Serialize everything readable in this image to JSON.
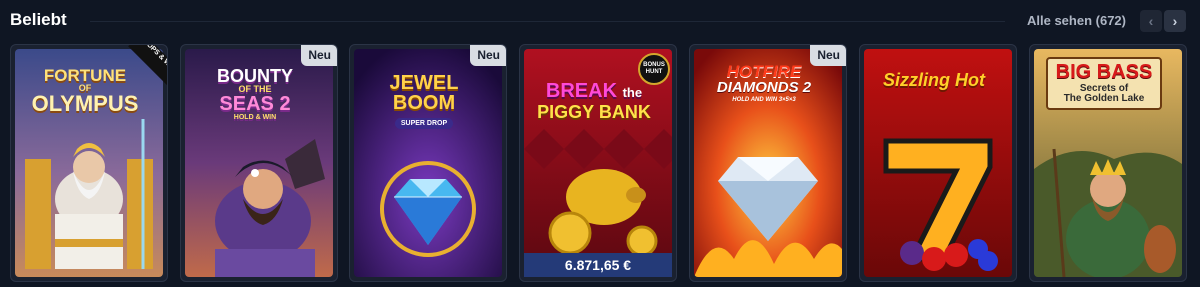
{
  "section": {
    "title": "Beliebt",
    "see_all_label": "Alle sehen (672)",
    "prev_icon": "‹",
    "next_icon": "›"
  },
  "games": [
    {
      "name": "Fortune of Olympus",
      "logo_line1": "FORTUNE",
      "logo_line2": "OF",
      "logo_line3": "OLYMPUS",
      "badge": "",
      "corner_badge": "DROPS & WINS"
    },
    {
      "name": "Bounty of the Seas 2",
      "logo_line1": "BOUNTY",
      "logo_line2": "OF THE",
      "logo_line3": "SEAS 2",
      "logo_line4": "HOLD & WIN",
      "badge": "Neu"
    },
    {
      "name": "Jewel Boom",
      "logo_line1": "JEWEL",
      "logo_line2": "BOOM",
      "logo_line3": "SUPER DROP",
      "badge": "Neu"
    },
    {
      "name": "Break the Piggy Bank",
      "logo_line1": "BREAK",
      "logo_line2": "the",
      "logo_line3": "PIGGY BANK",
      "badge": "",
      "corner_badge": "BONUS HUNT",
      "jackpot": "6.871,65 €"
    },
    {
      "name": "Hotfire Diamonds 2",
      "logo_line1": "HOTFIRE",
      "logo_line2": "DIAMONDS 2",
      "logo_line3": "HOLD AND WIN  3×5×3",
      "badge": "Neu"
    },
    {
      "name": "Sizzling Hot",
      "logo_line1": "Sizzling Hot",
      "badge": ""
    },
    {
      "name": "Big Bass Secrets of the Golden Lake",
      "logo_line1": "BIG BASS",
      "logo_line2": "Secrets of",
      "logo_line3": "The Golden Lake",
      "badge": ""
    }
  ],
  "colors": {
    "background": "#0f1623",
    "badge_new": "#d9dde3",
    "jackpot_bar": "#243a78"
  }
}
